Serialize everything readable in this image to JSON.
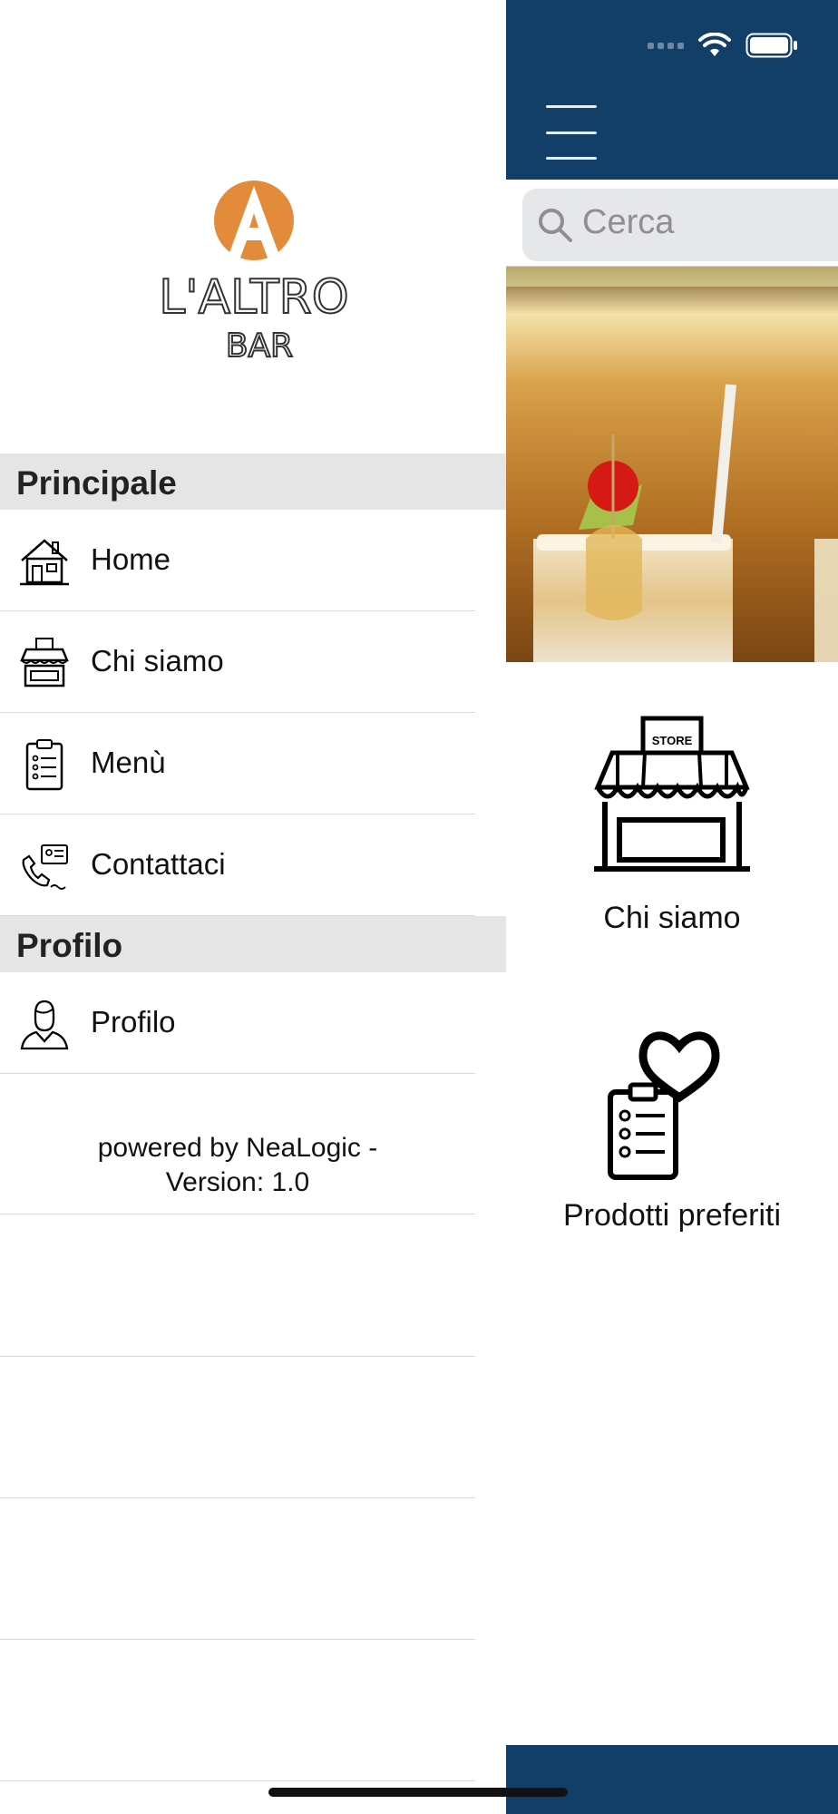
{
  "drawer": {
    "brand_lines": [
      "L'ALTRO",
      "BAR"
    ],
    "sections": [
      {
        "title": "Principale"
      },
      {
        "title": "Profilo"
      }
    ],
    "items": [
      {
        "label": "Home",
        "icon": "home-icon"
      },
      {
        "label": "Chi siamo",
        "icon": "store-icon"
      },
      {
        "label": "Menù",
        "icon": "clipboard-list-icon"
      },
      {
        "label": "Contattaci",
        "icon": "phone-contact-icon"
      },
      {
        "label": "Profilo",
        "icon": "user-icon"
      }
    ],
    "footer": "powered by NeaLogic - Version: 1.0"
  },
  "main": {
    "search_placeholder": "Cerca",
    "tiles": [
      {
        "label": "Chi siamo",
        "icon": "store-icon",
        "store_sign": "STORE"
      },
      {
        "label": "Prodotti preferiti",
        "icon": "favorites-icon"
      }
    ]
  },
  "colors": {
    "navbar": "#123f67",
    "logo_orange": "#e28b3b",
    "section_bg": "#e5e5e5"
  }
}
